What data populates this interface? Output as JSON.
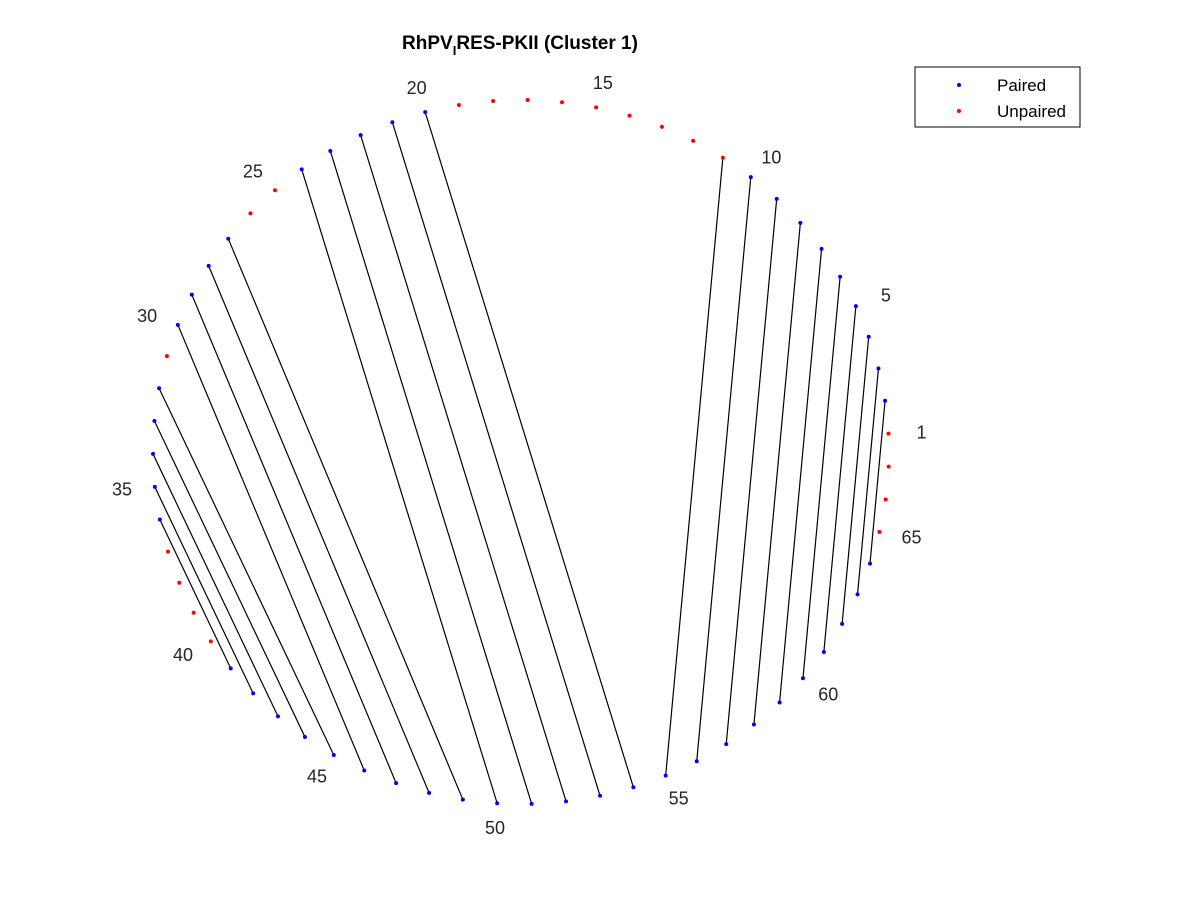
{
  "chart_data": {
    "type": "scatter",
    "title": {
      "main": "RhPV",
      "subscript": "I",
      "rest": "RES-PKII (Cluster 1)"
    },
    "n_positions": 67,
    "position_labels": [
      1,
      5,
      10,
      15,
      20,
      25,
      30,
      35,
      40,
      45,
      50,
      55,
      60,
      65
    ],
    "series": [
      {
        "name": "Paired",
        "color": "#0000ff",
        "positions": [
          2,
          3,
          4,
          5,
          6,
          7,
          8,
          9,
          10,
          20,
          21,
          22,
          23,
          24,
          27,
          28,
          29,
          30,
          32,
          33,
          34,
          35,
          36,
          41,
          42,
          43,
          44,
          45,
          46,
          47,
          48,
          49,
          50,
          51,
          52,
          53,
          54,
          55,
          56,
          57,
          58,
          59,
          60,
          61,
          62,
          63,
          64
        ]
      },
      {
        "name": "Unpaired",
        "color": "#ff0000",
        "positions": [
          1,
          11,
          12,
          13,
          14,
          15,
          16,
          17,
          18,
          19,
          25,
          26,
          31,
          37,
          38,
          39,
          40,
          65,
          66,
          67
        ]
      }
    ],
    "pairs": [
      [
        2,
        64
      ],
      [
        3,
        63
      ],
      [
        4,
        62
      ],
      [
        5,
        61
      ],
      [
        6,
        60
      ],
      [
        7,
        59
      ],
      [
        8,
        58
      ],
      [
        9,
        57
      ],
      [
        10,
        56
      ],
      [
        11,
        55
      ],
      [
        20,
        54
      ],
      [
        21,
        53
      ],
      [
        22,
        52
      ],
      [
        23,
        51
      ],
      [
        24,
        50
      ],
      [
        27,
        49
      ],
      [
        28,
        48
      ],
      [
        29,
        47
      ],
      [
        30,
        46
      ],
      [
        32,
        45
      ],
      [
        33,
        44
      ],
      [
        34,
        43
      ],
      [
        35,
        42
      ],
      [
        36,
        41
      ]
    ],
    "line_color": "#000000",
    "legend_position": "top-right"
  }
}
